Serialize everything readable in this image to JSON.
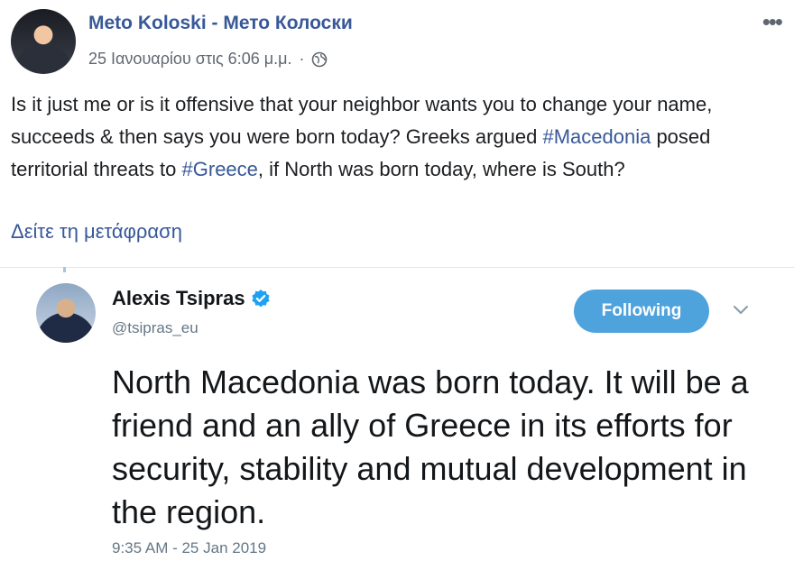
{
  "fb": {
    "author": "Meto Koloski - Мето Колоски",
    "date": "25 Ιανουαρίου στις 6:06 μ.μ.",
    "separator": "·",
    "more": "•••",
    "post": {
      "part1": "Is it just me or is it offensive that your neighbor wants you to change your name, succeeds & then says you were born today? Greeks argued ",
      "hashtag1": "#Macedonia",
      "part2": " posed territorial threats to ",
      "hashtag2": "#Greece",
      "part3": ", if North was born today, where is South?"
    },
    "translate": "Δείτε τη μετάφραση"
  },
  "tweet": {
    "name": "Alexis Tsipras",
    "handle": "@tsipras_eu",
    "follow_label": "Following",
    "text": "North Macedonia was born today. It will be a friend and an ally of Greece in its efforts for security, stability and mutual development in the region.",
    "time": "9:35 AM - 25 Jan 2019"
  },
  "colors": {
    "fb_link": "#385898",
    "twitter_blue": "#4ea3dc",
    "muted": "#657786"
  },
  "icons": [
    "globe-icon",
    "more-icon",
    "verified-icon",
    "chevron-down-icon"
  ]
}
